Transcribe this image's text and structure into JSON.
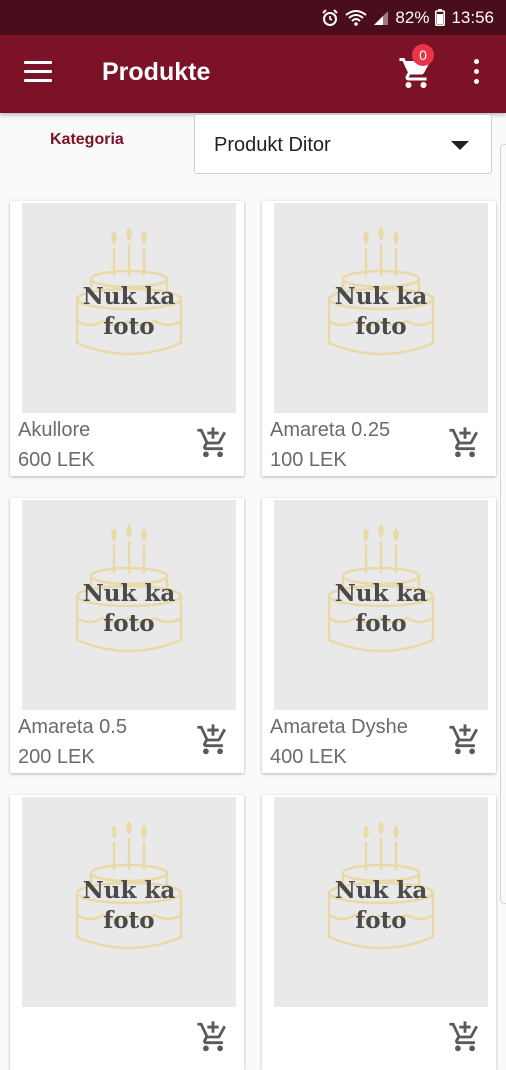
{
  "status_bar": {
    "battery": "82%",
    "time": "13:56"
  },
  "app_bar": {
    "title": "Produkte",
    "cart_count": "0",
    "icons": [
      "menu-icon",
      "cart-icon",
      "more-vert-icon"
    ]
  },
  "filter": {
    "label": "Kategoria",
    "selected": "Produkt Ditor"
  },
  "placeholder": {
    "line1": "Nuk ka",
    "line2": "foto"
  },
  "products": [
    {
      "name": "Akullore",
      "price": "600 LEK"
    },
    {
      "name": "Amareta 0.25",
      "price": "100 LEK"
    },
    {
      "name": "Amareta 0.5",
      "price": "200 LEK"
    },
    {
      "name": "Amareta Dyshe",
      "price": "400 LEK"
    },
    {
      "name": "",
      "price": ""
    },
    {
      "name": "",
      "price": ""
    }
  ],
  "colors": {
    "primary": "#7b1227",
    "status_bar": "#4a0d1b",
    "badge": "#e8354a",
    "placeholder_gold": "#e8d9a6",
    "placeholder_text": "#4a4a4a"
  }
}
